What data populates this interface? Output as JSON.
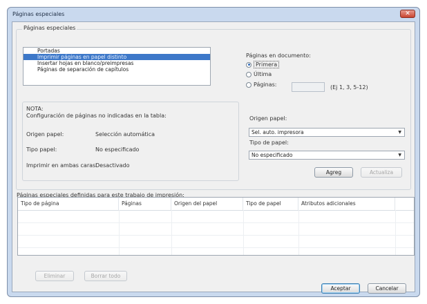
{
  "window": {
    "title": "Páginas especiales",
    "close_glyph": "✕"
  },
  "special_pages": {
    "group_label": "Páginas especiales",
    "items": [
      {
        "label": "Portadas",
        "selected": false
      },
      {
        "label": "Imprimir páginas en papel distinto",
        "selected": true
      },
      {
        "label": "Insertar hojas en blanco/preimpresas",
        "selected": false
      },
      {
        "label": "Páginas de separación de capítulos",
        "selected": false
      }
    ]
  },
  "pages_in_document": {
    "label": "Páginas en documento:",
    "options": [
      {
        "label": "Primera",
        "selected": true
      },
      {
        "label": "Última",
        "selected": false
      },
      {
        "label": "Páginas:",
        "selected": false
      }
    ],
    "pages_value": "",
    "example": "(Ej 1, 3, 5-12)"
  },
  "note": {
    "title": "NOTA:",
    "description": "Configuración de páginas no indicadas en la tabla:",
    "rows": [
      {
        "label": "Origen papel:",
        "value": "Selección automática"
      },
      {
        "label": "Tipo papel:",
        "value": "No especificado"
      },
      {
        "label": "Imprimir en ambas caras:",
        "value": "Desactivado"
      }
    ]
  },
  "paper_source": {
    "label": "Origen papel:",
    "value": "Sel. auto. impresora"
  },
  "paper_type": {
    "label": "Tipo de papel:",
    "value": "No especificado"
  },
  "actions": {
    "add": "Agreg",
    "update": "Actualiza"
  },
  "table": {
    "caption": "Páginas especiales definidas para este trabajo de impresión:",
    "columns": [
      "Tipo de página",
      "Páginas",
      "Origen del papel",
      "Tipo de papel",
      "Atributos adicionales"
    ],
    "rows": []
  },
  "footer": {
    "delete": "Eliminar",
    "delete_all": "Borrar todo",
    "ok": "Aceptar",
    "cancel": "Cancelar"
  }
}
